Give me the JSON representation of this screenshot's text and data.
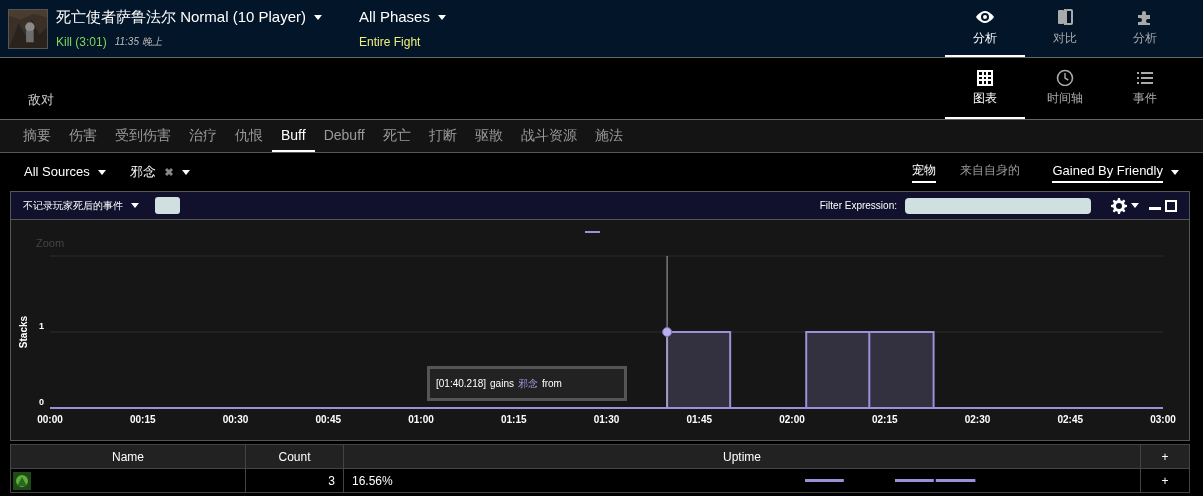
{
  "header": {
    "boss_title": "死亡使者萨鲁法尔 Normal (10 Player)",
    "result": "Kill (3:01)",
    "time": "11:35 晚上",
    "phase": "All Phases",
    "phase_sub": "Entire Fight",
    "view_tabs": [
      {
        "label": "分析",
        "selected": true
      },
      {
        "label": "对比",
        "selected": false
      },
      {
        "label": "分析",
        "selected": false
      }
    ]
  },
  "subheader": {
    "subtitle": "敌对",
    "mode_tabs": [
      {
        "label": "图表",
        "selected": true
      },
      {
        "label": "时间轴",
        "selected": false
      },
      {
        "label": "事件",
        "selected": false
      }
    ]
  },
  "nav_tabs": [
    {
      "label": "摘要",
      "selected": false
    },
    {
      "label": "伤害",
      "selected": false
    },
    {
      "label": "受到伤害",
      "selected": false
    },
    {
      "label": "治疗",
      "selected": false
    },
    {
      "label": "仇恨",
      "selected": false
    },
    {
      "label": "Buff",
      "selected": true
    },
    {
      "label": "Debuff",
      "selected": false
    },
    {
      "label": "死亡",
      "selected": false
    },
    {
      "label": "打断",
      "selected": false
    },
    {
      "label": "驱散",
      "selected": false
    },
    {
      "label": "战斗资源",
      "selected": false
    },
    {
      "label": "施法",
      "selected": false
    }
  ],
  "filters": {
    "source": "All Sources",
    "ability": "邪念",
    "toggles": [
      {
        "label": "宠物",
        "selected": true
      },
      {
        "label": "来自自身的",
        "selected": false
      }
    ],
    "gain_mode": "Gained By Friendly"
  },
  "panel": {
    "death_option": "不记录玩家死后的事件",
    "filter_label": "Filter Expression:",
    "zoom_label": "Zoom",
    "tooltip": [
      {
        "text": "[01:40.218]",
        "kind": "plain"
      },
      {
        "text": "gains",
        "kind": "plain"
      },
      {
        "text": "邪念",
        "kind": "ability"
      },
      {
        "text": "from",
        "kind": "plain"
      }
    ],
    "chart_data": {
      "type": "area",
      "ylabel": "Stacks",
      "xlim": [
        0,
        180
      ],
      "ylim": [
        0,
        2
      ],
      "yticks": [
        0,
        1
      ],
      "xticks": [
        {
          "value": 0,
          "label": "00:00"
        },
        {
          "value": 15,
          "label": "00:15"
        },
        {
          "value": 30,
          "label": "00:30"
        },
        {
          "value": 45,
          "label": "00:45"
        },
        {
          "value": 60,
          "label": "01:00"
        },
        {
          "value": 75,
          "label": "01:15"
        },
        {
          "value": 90,
          "label": "01:30"
        },
        {
          "value": 105,
          "label": "01:45"
        },
        {
          "value": 120,
          "label": "02:00"
        },
        {
          "value": 135,
          "label": "02:15"
        },
        {
          "value": 150,
          "label": "02:30"
        },
        {
          "value": 165,
          "label": "02:45"
        },
        {
          "value": 180,
          "label": "03:00"
        }
      ],
      "x": [
        0,
        99.8,
        99.8,
        110,
        110,
        122.3,
        122.3,
        132.5,
        132.5,
        132.5,
        142.9,
        142.9,
        180
      ],
      "series": [
        {
          "color": "#9d8fd8",
          "values": [
            0,
            0,
            1,
            1,
            0,
            0,
            1,
            1,
            0,
            1,
            1,
            0,
            0
          ]
        }
      ],
      "ref_lines": [
        {
          "axis": "x",
          "value": 99.8
        }
      ]
    }
  },
  "table": {
    "columns": [
      "Name",
      "Count",
      "Uptime",
      "+"
    ],
    "rows": [
      {
        "count": "3",
        "uptime": "16.56%",
        "action": "+"
      }
    ]
  }
}
